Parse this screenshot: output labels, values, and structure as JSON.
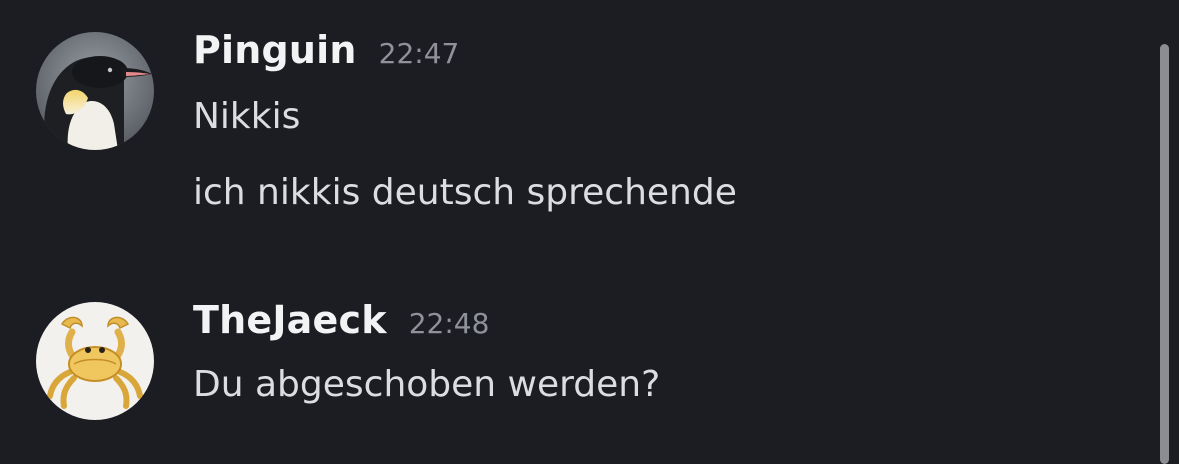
{
  "messages": [
    {
      "author": "Pinguin",
      "time": "22:47",
      "avatar_icon": "penguin-icon",
      "lines": [
        "Nikkis",
        "ich nikkis deutsch sprechende"
      ]
    },
    {
      "author": "TheJaeck",
      "time": "22:48",
      "avatar_icon": "crab-icon",
      "lines": [
        "Du abgeschoben werden?"
      ]
    }
  ],
  "colors": {
    "background": "#1c1d22",
    "username": "#f2f3f5",
    "timestamp": "#8f929a",
    "message_text": "#dcdde1",
    "scrollbar": "#8b8d93"
  }
}
